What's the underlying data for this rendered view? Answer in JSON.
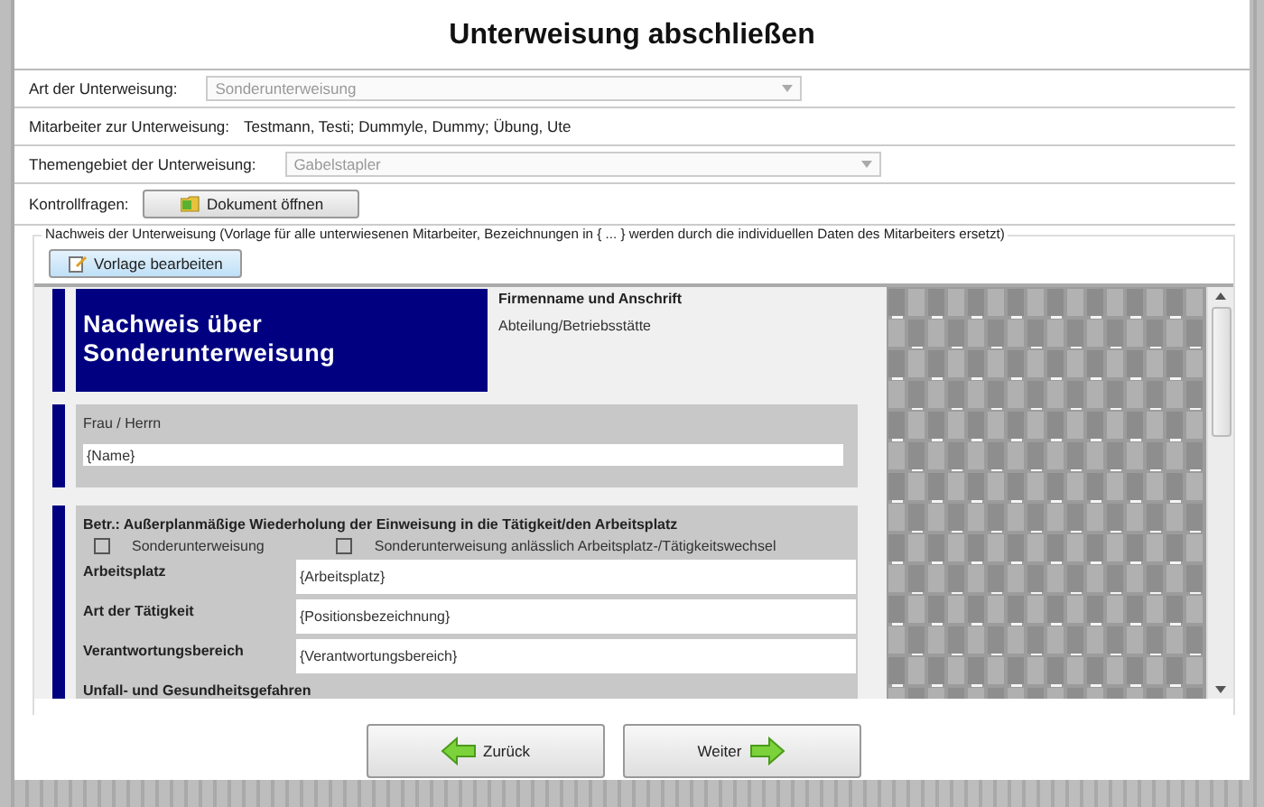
{
  "title": "Unterweisung abschließen",
  "fields": [
    {
      "kind": "dropdown",
      "label": "Art der Unterweisung:",
      "value": "Sonderunterweisung",
      "disabled": true
    },
    {
      "kind": "text",
      "label": "Mitarbeiter zur Unterweisung:",
      "value": "Testmann, Testi; Dummyle, Dummy; Übung, Ute"
    },
    {
      "kind": "dropdown",
      "label": "Themengebiet der Unterweisung:",
      "value": "Gabelstapler",
      "disabled": true
    },
    {
      "kind": "button",
      "label": "Kontrollfragen:",
      "value": "Dokument öffnen"
    }
  ],
  "template_group": {
    "legend": "Nachweis der Unterweisung (Vorlage für alle unterwiesenen Mitarbeiter, Bezeichnungen in { ... } werden durch die individuellen Daten des Mitarbeiters ersetzt)",
    "edit_button": "Vorlage bearbeiten"
  },
  "document": {
    "title": "Nachweis über Sonderunterweisung",
    "company": "Firmenname und Anschrift",
    "department": "Abteilung/Betriebsstätte",
    "recipient": {
      "label": "Frau / Herrn",
      "value": "{Name}"
    },
    "subject": "Betr.: Außerplanmäßige Wiederholung der Einweisung in die Tätigkeit/den Arbeitsplatz",
    "options": [
      {
        "label": "Sonderunterweisung",
        "checked": false
      },
      {
        "label": "Sonderunterweisung anlässlich Arbeitsplatz-/Tätigkeitswechsel",
        "checked": false
      }
    ],
    "rows": [
      {
        "label": "Arbeitsplatz",
        "value": "{Arbeitsplatz}"
      },
      {
        "label": "Art der Tätigkeit",
        "value": "{Positionsbezeichnung}"
      },
      {
        "label": "Verantwortungsbereich",
        "value": "{Verantwortungsbereich}"
      }
    ],
    "next_heading": "Unfall- und Gesundheitsgefahren"
  },
  "nav_buttons": [
    {
      "kind": "back",
      "label": "Zurück"
    },
    {
      "kind": "forward",
      "label": "Weiter"
    }
  ]
}
